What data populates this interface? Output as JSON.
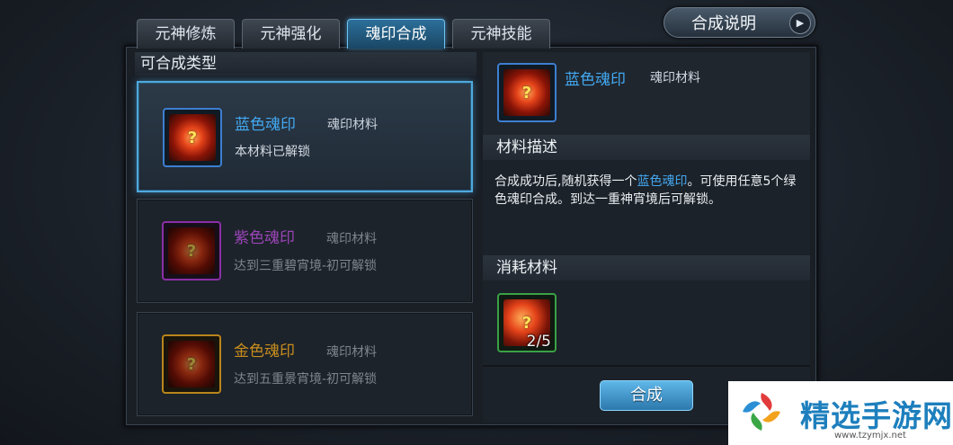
{
  "tabs": [
    {
      "label": "元神修炼",
      "active": false
    },
    {
      "label": "元神强化",
      "active": false
    },
    {
      "label": "魂印合成",
      "active": true
    },
    {
      "label": "元神技能",
      "active": false
    }
  ],
  "help_button": {
    "label": "合成说明"
  },
  "left_panel": {
    "title": "可合成类型",
    "items": [
      {
        "name": "蓝色魂印",
        "tag": "魂印材料",
        "status": "本材料已解锁",
        "name_color": "#43a8f0",
        "selected": true
      },
      {
        "name": "紫色魂印",
        "tag": "魂印材料",
        "status": "达到三重碧宵境-初可解锁",
        "name_color": "#9a45b8",
        "selected": false
      },
      {
        "name": "金色魂印",
        "tag": "魂印材料",
        "status": "达到五重景宵境-初可解锁",
        "name_color": "#c98d1d",
        "selected": false
      }
    ]
  },
  "detail": {
    "name": "蓝色魂印",
    "tag": "魂印材料",
    "desc_header": "材料描述",
    "desc_prefix": "合成成功后,随机获得一个",
    "desc_highlight": "蓝色魂印",
    "desc_suffix": "。可使用任意5个绿色魂印合成。到达一重神宵境后可解锁。",
    "cost_header": "消耗材料",
    "cost_count": "2/5",
    "combine_label": "合成"
  },
  "watermark": {
    "brand": "精选手游网",
    "url": "www.tzymjx.net"
  },
  "icons": {
    "help_arrow": "play-triangle-icon",
    "item": "soul-seal-icon"
  }
}
